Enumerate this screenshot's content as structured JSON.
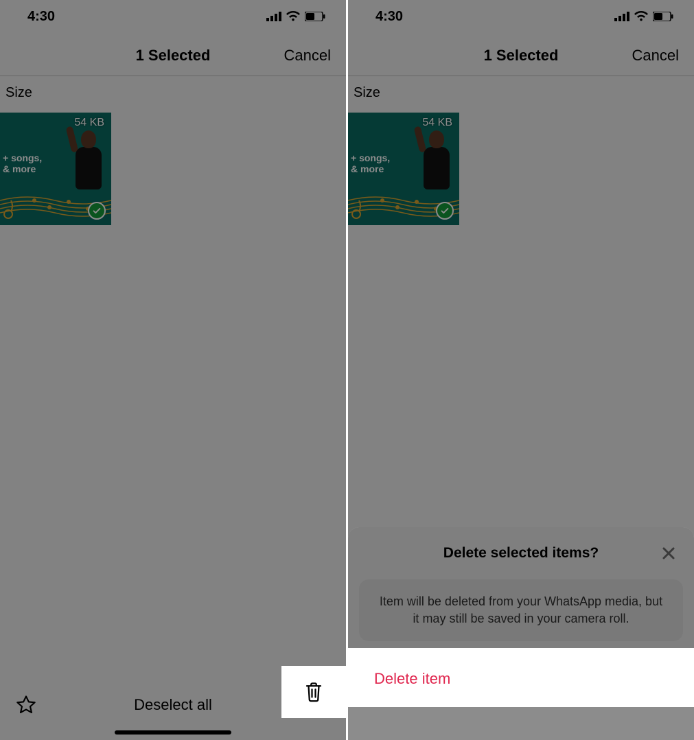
{
  "status": {
    "time": "4:30"
  },
  "nav": {
    "title": "1 Selected",
    "cancel": "Cancel"
  },
  "section": {
    "label": "Size"
  },
  "thumb": {
    "size": "54 KB",
    "line1": "+ songs,",
    "line2": "& more"
  },
  "toolbar": {
    "deselect": "Deselect all"
  },
  "sheet": {
    "title": "Delete selected items?",
    "message": "Item will be deleted from your WhatsApp media, but it may still be saved in your camera roll.",
    "action": "Delete item"
  }
}
